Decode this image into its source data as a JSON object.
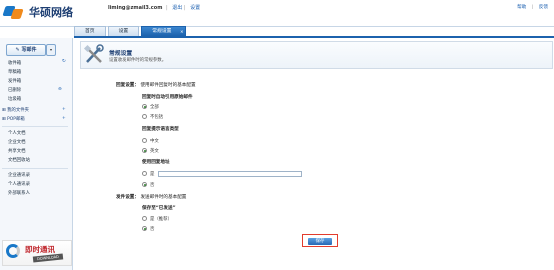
{
  "brand": {
    "name": "华硕网络"
  },
  "account": {
    "email": "liming@zmail3.com",
    "logout": "退出",
    "settings": "设置"
  },
  "top_links": [
    "帮助",
    "反馈"
  ],
  "tabs": [
    {
      "label": "首页"
    },
    {
      "label": "设置"
    },
    {
      "label": "常规设置"
    }
  ],
  "sidebar": {
    "compose": "写邮件",
    "folders": [
      {
        "label": "收件箱",
        "count": ""
      },
      {
        "label": "草稿箱",
        "count": ""
      },
      {
        "label": "发件箱",
        "count": ""
      },
      {
        "label": "已删除",
        "count": ""
      },
      {
        "label": "垃圾箱",
        "count": ""
      }
    ],
    "my_folders": "我的文件夹",
    "pop_mail": "POP邮箱",
    "docs": [
      "个人文档",
      "企业文档",
      "共享文档",
      "文档回收站"
    ],
    "contacts": [
      "企业通讯录",
      "个人通讯录",
      "外部联系人"
    ],
    "im_promo": {
      "title": "即时通讯",
      "download": "DOWNLOAD"
    }
  },
  "header": {
    "title": "常规设置",
    "subtitle": "设置收发邮件时的常规参数。"
  },
  "reply": {
    "section_label": "回复设置：",
    "section_desc": "使用邮件回复时的基本配置",
    "auto_quote_label": "回复时自动引用原始邮件",
    "auto_quote_options": [
      "全部",
      "不包括"
    ],
    "lang_label": "回复提示语言类型",
    "lang_options": [
      "中文",
      "英文"
    ],
    "addr_label": "使用回复地址",
    "addr_yes": "是",
    "addr_no": "否",
    "addr_value": ""
  },
  "send": {
    "section_label": "发件设置：",
    "section_desc": "发送邮件时的基本配置",
    "save_label": "保存至“已发送”",
    "save_options": [
      "是（推荐）",
      "否"
    ]
  },
  "save_button": "保存"
}
